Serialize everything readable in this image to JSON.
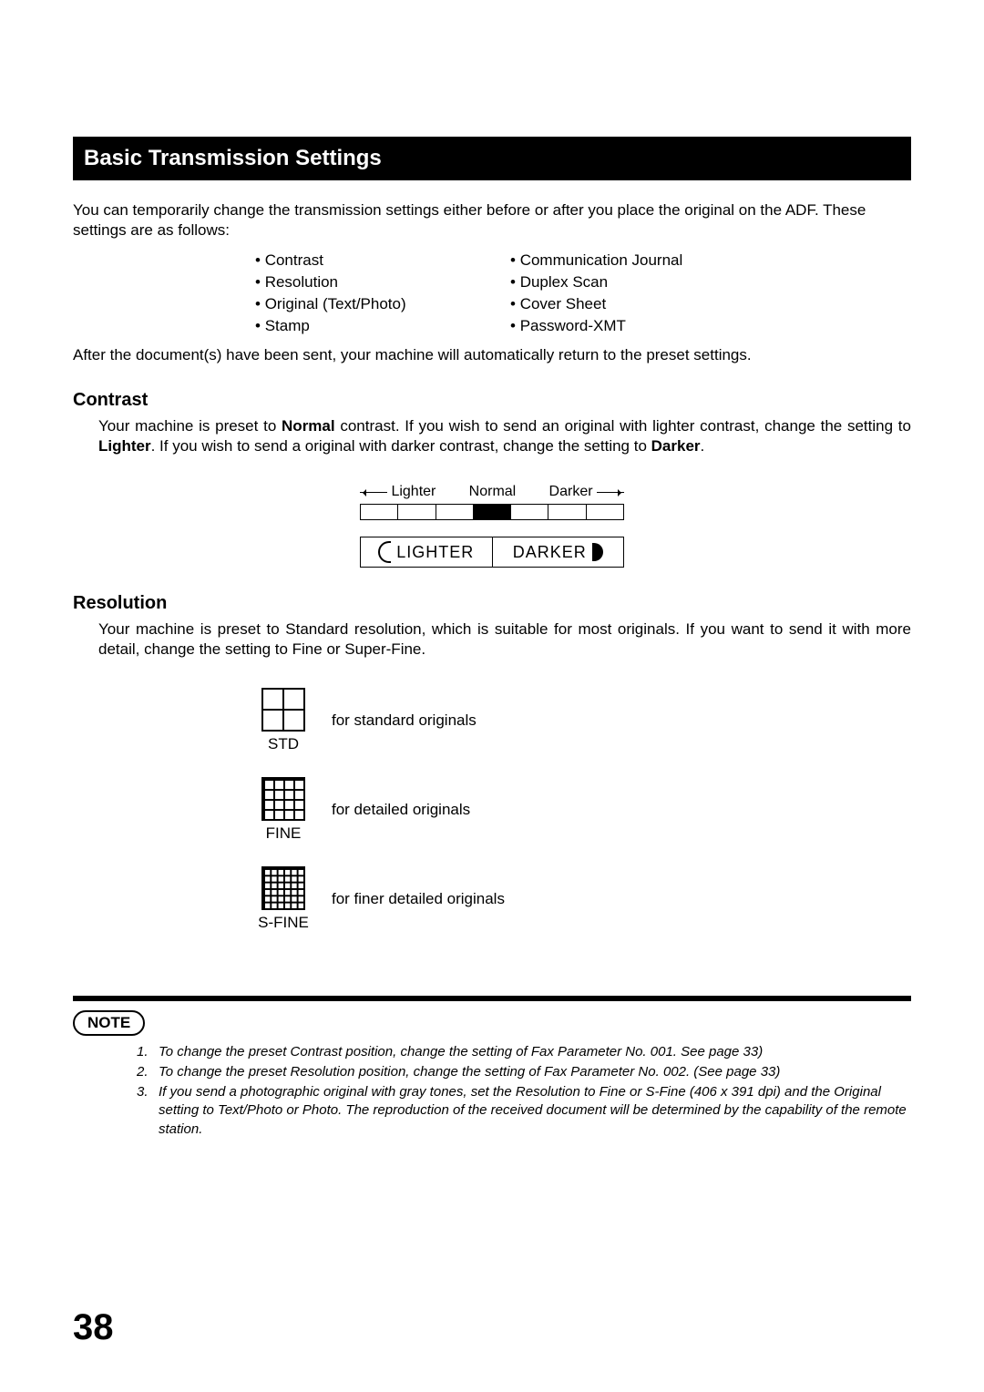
{
  "header": "Basic Transmission Settings",
  "intro": "You can temporarily change the transmission settings either before or after you place the original on the ADF.  These settings are as follows:",
  "settings": {
    "left": [
      "Contrast",
      "Resolution",
      "Original (Text/Photo)",
      "Stamp"
    ],
    "right": [
      "Communication Journal",
      "Duplex Scan",
      "Cover Sheet",
      "Password-XMT"
    ]
  },
  "after": "After the document(s) have been sent, your machine will automatically return to the preset settings.",
  "contrast": {
    "title": "Contrast",
    "body_pre": "Your machine is preset to ",
    "body_bold1": "Normal",
    "body_mid": " contrast.  If you wish to send an original with lighter contrast, change the setting to ",
    "body_bold2": "Lighter",
    "body_mid2": ".  If you wish to send a original with darker contrast, change the setting to ",
    "body_bold3": "Darker",
    "body_end": ".",
    "labels": {
      "lighter": "Lighter",
      "normal": "Normal",
      "darker": "Darker"
    },
    "buttons": {
      "lighter": "LIGHTER",
      "darker": "DARKER"
    }
  },
  "resolution": {
    "title": "Resolution",
    "body": "Your machine is preset to Standard resolution, which is suitable for most originals.  If you want to send it with more detail, change the setting to Fine or Super-Fine.",
    "rows": [
      {
        "label": "STD",
        "desc": "for standard originals"
      },
      {
        "label": "FINE",
        "desc": "for detailed originals"
      },
      {
        "label": "S-FINE",
        "desc": "for finer detailed originals"
      }
    ]
  },
  "note": {
    "title": "NOTE",
    "items": [
      "To change the preset Contrast position, change the setting of Fax Parameter No. 001.  See page 33)",
      "To change the preset Resolution position, change the setting of Fax Parameter No. 002.  (See page 33)",
      "If you send a photographic original with gray tones, set the Resolution to Fine or S-Fine (406 x 391 dpi) and the Original setting to Text/Photo or Photo.  The reproduction of the received document will be determined by the capability of the remote station."
    ]
  },
  "page_number": "38"
}
